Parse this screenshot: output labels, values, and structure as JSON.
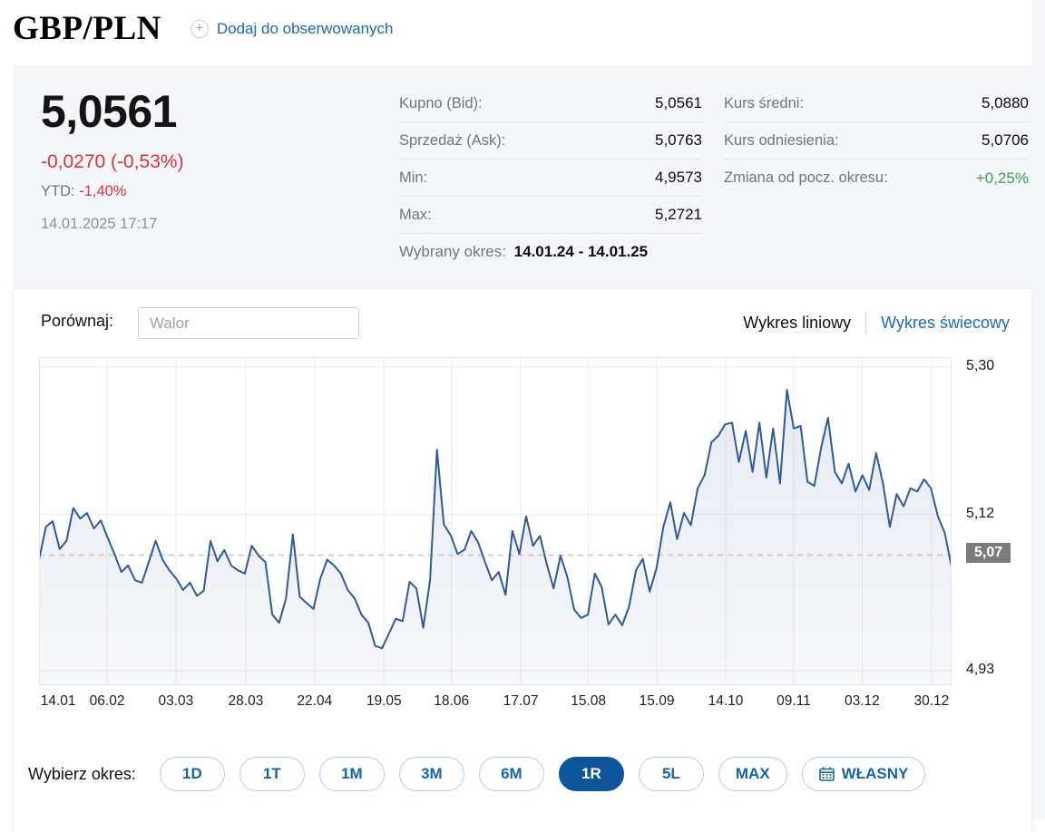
{
  "header": {
    "title": "GBP/PLN",
    "add_watch_label": "Dodaj do obserwowanych"
  },
  "quote": {
    "price": "5,0561",
    "change": "-0,0270 (-0,53%)",
    "ytd_label": "YTD:",
    "ytd_value": "-1,40%",
    "timestamp": "14.01.2025 17:17",
    "table1": [
      {
        "label": "Kupno (Bid):",
        "value": "5,0561"
      },
      {
        "label": "Sprzedaż (Ask):",
        "value": "5,0763"
      },
      {
        "label": "Min:",
        "value": "4,9573"
      },
      {
        "label": "Max:",
        "value": "5,2721"
      }
    ],
    "table2": [
      {
        "label": "Kurs średni:",
        "value": "5,0880"
      },
      {
        "label": "Kurs odniesienia:",
        "value": "5,0706"
      },
      {
        "label": "Zmiana od pocz. okresu:",
        "value": "+0,25%",
        "positive": true
      }
    ],
    "selected_period_label": "Wybrany okres:",
    "selected_period_value": "14.01.24 - 14.01.25"
  },
  "controls": {
    "compare_label": "Porównaj:",
    "compare_placeholder": "Walor",
    "chart_type_line": "Wykres liniowy",
    "chart_type_candle": "Wykres świecowy"
  },
  "chart_data": {
    "type": "line",
    "title": "GBP/PLN, okres 1R (14.01.24 - 14.01.25)",
    "ylim": [
      4.912,
      5.312
    ],
    "y_ticks": [
      {
        "value": 5.3,
        "label": "5,30"
      },
      {
        "value": 5.12,
        "label": "5,12"
      },
      {
        "value": 4.93,
        "label": "4,93"
      }
    ],
    "reference_value": 5.0706,
    "reference_tag": "5,07",
    "last_value": 5.0561,
    "min_value": 4.9573,
    "max_value": 5.2721,
    "x_ticks": [
      {
        "label": "14.01",
        "f": 0.021,
        "grid": false
      },
      {
        "label": "06.02",
        "f": 0.0746,
        "grid": true
      },
      {
        "label": "03.03",
        "f": 0.15,
        "grid": true
      },
      {
        "label": "28.03",
        "f": 0.2266,
        "grid": true
      },
      {
        "label": "22.04",
        "f": 0.302,
        "grid": true
      },
      {
        "label": "19.05",
        "f": 0.378,
        "grid": true
      },
      {
        "label": "18.06",
        "f": 0.452,
        "grid": true
      },
      {
        "label": "17.07",
        "f": 0.528,
        "grid": true
      },
      {
        "label": "15.08",
        "f": 0.602,
        "grid": true
      },
      {
        "label": "15.09",
        "f": 0.677,
        "grid": true
      },
      {
        "label": "14.10",
        "f": 0.7525,
        "grid": true
      },
      {
        "label": "09.11",
        "f": 0.827,
        "grid": true
      },
      {
        "label": "03.12",
        "f": 0.902,
        "grid": true
      },
      {
        "label": "30.12",
        "f": 0.978,
        "grid": true
      }
    ],
    "values": [
      5.065,
      5.105,
      5.112,
      5.078,
      5.088,
      5.128,
      5.115,
      5.122,
      5.103,
      5.113,
      5.092,
      5.072,
      5.05,
      5.058,
      5.04,
      5.037,
      5.062,
      5.088,
      5.065,
      5.052,
      5.042,
      5.028,
      5.037,
      5.021,
      5.027,
      5.088,
      5.063,
      5.077,
      5.058,
      5.052,
      5.048,
      5.082,
      5.07,
      5.062,
      4.998,
      4.988,
      5.018,
      5.096,
      5.02,
      5.012,
      5.005,
      5.042,
      5.065,
      5.058,
      5.048,
      5.028,
      5.018,
      4.998,
      4.988,
      4.96,
      4.957,
      4.975,
      4.993,
      4.99,
      5.038,
      5.03,
      4.982,
      5.04,
      5.199,
      5.108,
      5.095,
      5.072,
      5.077,
      5.1,
      5.086,
      5.062,
      5.04,
      5.05,
      5.022,
      5.1,
      5.072,
      5.118,
      5.082,
      5.094,
      5.06,
      5.03,
      5.07,
      5.044,
      5.004,
      4.994,
      4.998,
      5.048,
      5.032,
      4.986,
      4.998,
      4.985,
      5.008,
      5.052,
      5.066,
      5.026,
      5.055,
      5.105,
      5.135,
      5.09,
      5.122,
      5.107,
      5.152,
      5.168,
      5.208,
      5.216,
      5.23,
      5.232,
      5.184,
      5.222,
      5.172,
      5.232,
      5.165,
      5.225,
      5.158,
      5.272,
      5.225,
      5.228,
      5.16,
      5.155,
      5.202,
      5.238,
      5.172,
      5.158,
      5.182,
      5.148,
      5.168,
      5.15,
      5.195,
      5.158,
      5.105,
      5.145,
      5.13,
      5.152,
      5.148,
      5.163,
      5.152,
      5.118,
      5.098,
      5.0561
    ]
  },
  "periods": {
    "label": "Wybierz okres:",
    "buttons": [
      {
        "label": "1D",
        "active": false
      },
      {
        "label": "1T",
        "active": false
      },
      {
        "label": "1M",
        "active": false
      },
      {
        "label": "3M",
        "active": false
      },
      {
        "label": "6M",
        "active": false
      },
      {
        "label": "1R",
        "active": true
      },
      {
        "label": "5L",
        "active": false
      },
      {
        "label": "MAX",
        "active": false
      },
      {
        "label": "WŁASNY",
        "active": false,
        "icon": "calendar"
      }
    ]
  },
  "colors": {
    "line": "#2d5b9c",
    "fill": "rgba(72, 94, 153, 0.09)",
    "grid": "#ececec",
    "border": "#e7e7e7",
    "dashed": "#c6c6c6",
    "red": "#d8353c",
    "green": "#3ca04d",
    "link_blue": "#1b6cac",
    "active_blue": "#0e549b",
    "tag_bg": "#7c7c7c"
  }
}
